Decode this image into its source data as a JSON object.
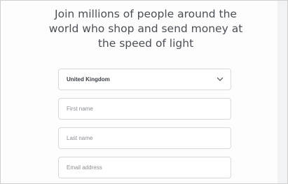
{
  "headline": "Join millions of people around the world who shop and send money at the speed of light",
  "country_select": {
    "value": "United Kingdom",
    "icon": "chevron-down-icon"
  },
  "first_name": {
    "placeholder": "First name",
    "value": ""
  },
  "last_name": {
    "placeholder": "Last name",
    "value": ""
  },
  "email": {
    "placeholder": "Email address",
    "value": ""
  },
  "colors": {
    "text": "#4a4f55",
    "border": "#d6d9dc",
    "background": "#fdfdfd"
  }
}
